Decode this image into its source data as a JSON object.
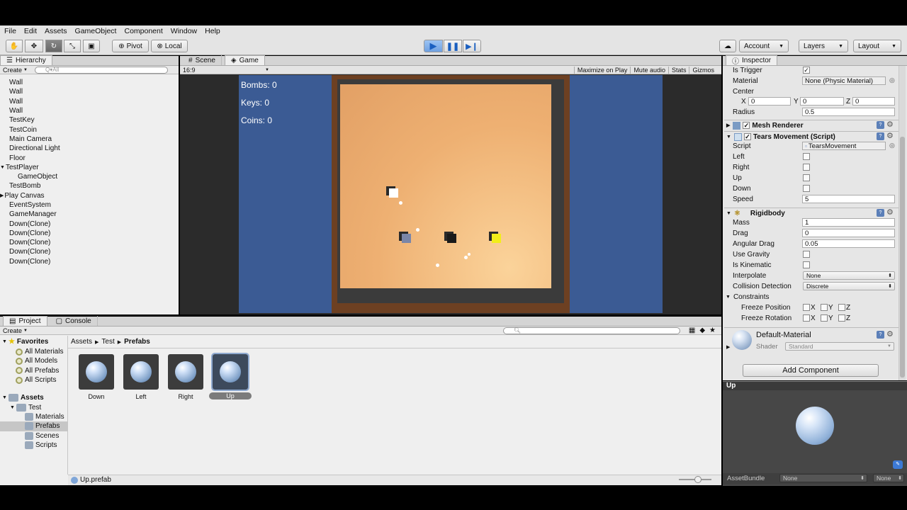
{
  "menu": [
    "File",
    "Edit",
    "Assets",
    "GameObject",
    "Component",
    "Window",
    "Help"
  ],
  "toolbar": {
    "pivot": "Pivot",
    "local": "Local",
    "account": "Account",
    "layers": "Layers",
    "layout": "Layout"
  },
  "hierarchy": {
    "tab": "Hierarchy",
    "create": "Create",
    "search_placeholder": "Q▾All",
    "items": [
      {
        "label": "Wall",
        "indent": 0,
        "arrow": ""
      },
      {
        "label": "Wall",
        "indent": 0,
        "arrow": ""
      },
      {
        "label": "Wall",
        "indent": 0,
        "arrow": ""
      },
      {
        "label": "Wall",
        "indent": 0,
        "arrow": ""
      },
      {
        "label": "TestKey",
        "indent": 0,
        "arrow": ""
      },
      {
        "label": "TestCoin",
        "indent": 0,
        "arrow": ""
      },
      {
        "label": "Main Camera",
        "indent": 0,
        "arrow": ""
      },
      {
        "label": "Directional Light",
        "indent": 0,
        "arrow": ""
      },
      {
        "label": "Floor",
        "indent": 0,
        "arrow": ""
      },
      {
        "label": "TestPlayer",
        "indent": 0,
        "arrow": "▼"
      },
      {
        "label": "GameObject",
        "indent": 1,
        "arrow": ""
      },
      {
        "label": "TestBomb",
        "indent": 0,
        "arrow": ""
      },
      {
        "label": "Play Canvas",
        "indent": 0,
        "arrow": "▶"
      },
      {
        "label": "EventSystem",
        "indent": 0,
        "arrow": ""
      },
      {
        "label": "GameManager",
        "indent": 0,
        "arrow": ""
      },
      {
        "label": "Down(Clone)",
        "indent": 0,
        "arrow": ""
      },
      {
        "label": "Down(Clone)",
        "indent": 0,
        "arrow": ""
      },
      {
        "label": "Down(Clone)",
        "indent": 0,
        "arrow": ""
      },
      {
        "label": "Down(Clone)",
        "indent": 0,
        "arrow": ""
      },
      {
        "label": "Down(Clone)",
        "indent": 0,
        "arrow": ""
      }
    ]
  },
  "game": {
    "tabs": [
      "Scene",
      "Game"
    ],
    "aspect": "16:9",
    "buttons": [
      "Maximize on Play",
      "Mute audio",
      "Stats",
      "Gizmos"
    ],
    "hud": {
      "bombs": "Bombs: 0",
      "keys": "Keys: 0",
      "coins": "Coins: 0"
    }
  },
  "project": {
    "tabs": [
      "Project",
      "Console"
    ],
    "create": "Create",
    "breadcrumb": [
      "Assets",
      "Test",
      "Prefabs"
    ],
    "favorites_label": "Favorites",
    "favorites": [
      "All Materials",
      "All Models",
      "All Prefabs",
      "All Scripts"
    ],
    "assets_label": "Assets",
    "test_label": "Test",
    "test_children": [
      "Materials",
      "Prefabs",
      "Scenes",
      "Scripts"
    ],
    "prefabs": [
      "Down",
      "Left",
      "Right",
      "Up"
    ],
    "footer": "Up.prefab"
  },
  "inspector": {
    "tab": "Inspector",
    "collider": {
      "is_trigger": "Is Trigger",
      "material_label": "Material",
      "material_value": "None (Physic Material)",
      "center": "Center",
      "x": "X",
      "x_val": "0",
      "y": "Y",
      "y_val": "0",
      "z": "Z",
      "z_val": "0",
      "radius_label": "Radius",
      "radius_value": "0.5"
    },
    "mesh_renderer": "Mesh Renderer",
    "tears": {
      "title": "Tears Movement (Script)",
      "script_label": "Script",
      "script_value": "TearsMovement",
      "left": "Left",
      "right": "Right",
      "up": "Up",
      "down": "Down",
      "speed_label": "Speed",
      "speed_value": "5"
    },
    "rigidbody": {
      "title": "Rigidbody",
      "mass_label": "Mass",
      "mass": "1",
      "drag_label": "Drag",
      "drag": "0",
      "angular_label": "Angular Drag",
      "angular": "0.05",
      "gravity": "Use Gravity",
      "kinematic": "Is Kinematic",
      "interpolate_label": "Interpolate",
      "interpolate": "None",
      "collision_label": "Collision Detection",
      "collision": "Discrete",
      "constraints": "Constraints",
      "freeze_pos": "Freeze Position",
      "freeze_rot": "Freeze Rotation",
      "X": "X",
      "Y": "Y",
      "Z": "Z"
    },
    "material": {
      "name": "Default-Material",
      "shader_label": "Shader",
      "shader": "Standard"
    },
    "add_component": "Add Component",
    "preview_title": "Up",
    "assetbundle_label": "AssetBundle",
    "assetbundle": "None",
    "variant": "None"
  }
}
